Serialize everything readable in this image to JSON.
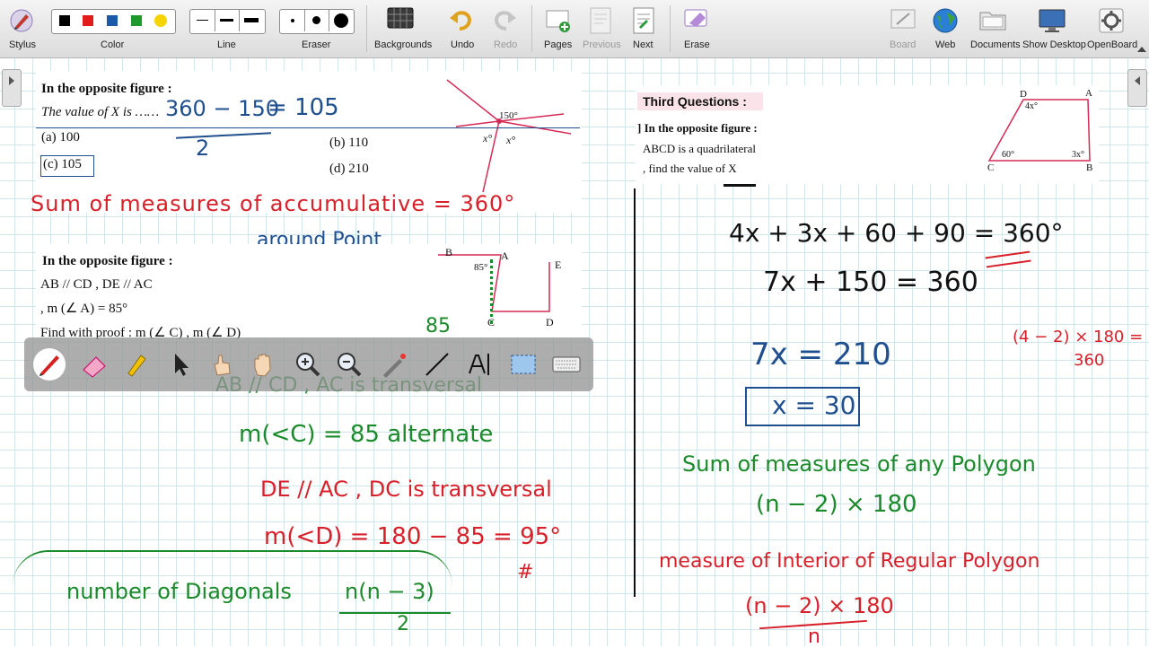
{
  "toolbar": {
    "stylus": "Stylus",
    "color": "Color",
    "line": "Line",
    "eraser": "Eraser",
    "backgrounds": "Backgrounds",
    "undo": "Undo",
    "redo": "Redo",
    "pages": "Pages",
    "previous": "Previous",
    "next": "Next",
    "erase": "Erase",
    "board": "Board",
    "web": "Web",
    "documents": "Documents",
    "show_desktop": "Show Desktop",
    "openboard": "OpenBoard",
    "colors": [
      "#000000",
      "#e21b1b",
      "#1b5aa8",
      "#1e9a2c",
      "#f5d400"
    ]
  },
  "q1": {
    "title": "In the opposite figure :",
    "prompt": "The value of X is ……",
    "a": "(a) 100",
    "b": "(b) 110",
    "c": "(c) 105",
    "d": "(d) 210",
    "angle": "150°",
    "x1": "x°",
    "x2": "x°"
  },
  "q2": {
    "title": "In the opposite figure :",
    "given1": "AB // CD , DE // AC",
    "given2": ", m (∠ A) = 85°",
    "find": "Find with proof : m (∠ C) , m (∠ D)",
    "B": "B",
    "A": "A",
    "E": "E",
    "C": "C",
    "D": "D",
    "angle": "85°"
  },
  "q3": {
    "header": "Third Questions :",
    "title": "] In the opposite figure :",
    "line2": "ABCD is a quadrilateral",
    "line3": ", find the value of X",
    "D": "D",
    "A": "A",
    "C": "C",
    "B": "B",
    "a_d": "4x°",
    "a_c": "60°",
    "a_b": "3x°"
  },
  "ink": {
    "q1_calc_num": "360 − 150",
    "q1_calc_den": "2",
    "q1_calc_res": "= 105",
    "sum_around": "Sum of measures of accumulative = 360°",
    "around_point": "around Point",
    "q2_85": "85",
    "ab_cd": "AB // CD , AC is transversal",
    "mc": "m(<C) = 85      alternate",
    "de_ac": "DE // AC  ,  DC is transversal",
    "md": "m(<D) = 180 − 85 = 95°",
    "hash": "#",
    "diagonals": "number of Diagonals",
    "diag_formula_num": "n(n − 3)",
    "diag_formula_den": "2",
    "eq1": "4x + 3x + 60 + 90 = 360°",
    "eq2": "7x + 150 = 360",
    "eq3": "7x = 210",
    "eq4": "x = 30",
    "side_calc_1": "(4 − 2) × 180 =",
    "side_calc_2": "360",
    "sum_polygon": "Sum of measures of any Polygon",
    "sum_formula": "(n − 2) × 180",
    "interior": "measure of Interior of Regular Polygon",
    "interior_num": "(n − 2) × 180",
    "interior_den": "n"
  }
}
